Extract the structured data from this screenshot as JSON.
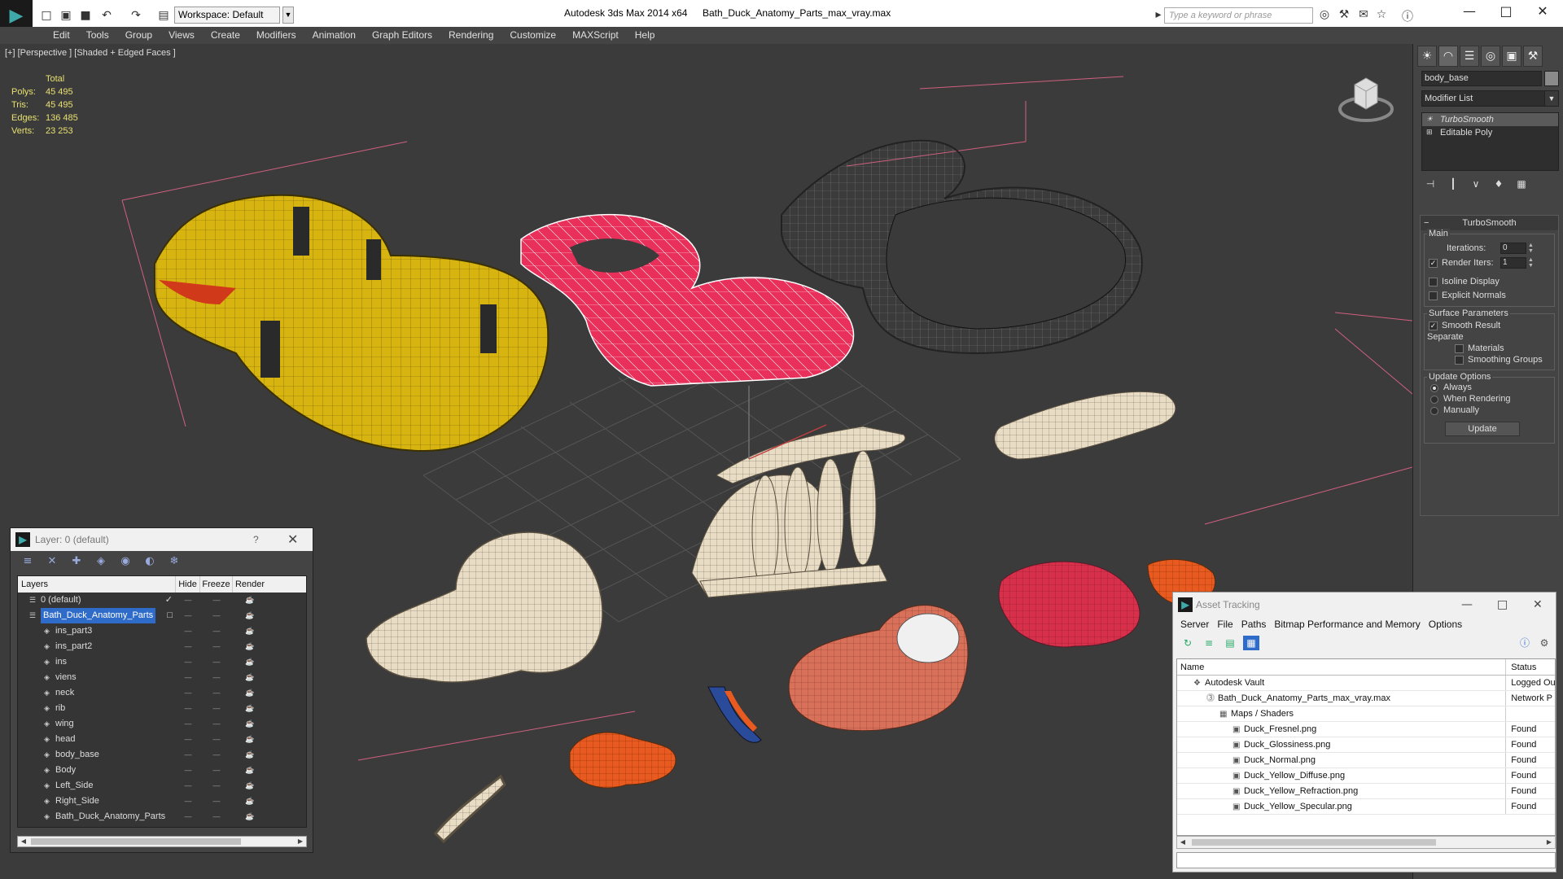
{
  "titlebar": {
    "app_title": "Autodesk 3ds Max  2014 x64",
    "file_title": "Bath_Duck_Anatomy_Parts_max_vray.max",
    "workspace": "Workspace: Default",
    "search_placeholder": "Type a keyword or phrase"
  },
  "menu": [
    "Edit",
    "Tools",
    "Group",
    "Views",
    "Create",
    "Modifiers",
    "Animation",
    "Graph Editors",
    "Rendering",
    "Customize",
    "MAXScript",
    "Help"
  ],
  "viewport": {
    "label": "[+] [Perspective ] [Shaded + Edged Faces ]",
    "stats_header": "Total",
    "stats": [
      {
        "label": "Polys:",
        "value": "45 495"
      },
      {
        "label": "Tris:",
        "value": "45 495"
      },
      {
        "label": "Edges:",
        "value": "136 485"
      },
      {
        "label": "Verts:",
        "value": "23 253"
      }
    ]
  },
  "command_panel": {
    "object_name": "body_base",
    "modifier_list": "Modifier List",
    "stack": [
      "TurboSmooth",
      "Editable Poly"
    ],
    "rollout_title": "TurboSmooth",
    "main_group": "Main",
    "iterations_label": "Iterations:",
    "iterations_value": "0",
    "render_iters_label": "Render Iters:",
    "render_iters_value": "1",
    "isoline_label": "Isoline Display",
    "explicit_normals_label": "Explicit Normals",
    "surface_params_group": "Surface Parameters",
    "smooth_result_label": "Smooth Result",
    "separate_label": "Separate",
    "materials_label": "Materials",
    "smoothing_groups_label": "Smoothing Groups",
    "update_options_group": "Update Options",
    "always_label": "Always",
    "when_rendering_label": "When Rendering",
    "manually_label": "Manually",
    "update_button": "Update"
  },
  "layer_panel": {
    "title": "Layer: 0 (default)",
    "help": "?",
    "columns": {
      "layers": "Layers",
      "hide": "Hide",
      "freeze": "Freeze",
      "render": "Render"
    },
    "rows": [
      {
        "name": "0 (default)",
        "indent": 0,
        "checked": true,
        "selected": false
      },
      {
        "name": "Bath_Duck_Anatomy_Parts",
        "indent": 0,
        "checked": false,
        "selected": true
      },
      {
        "name": "ins_part3",
        "indent": 1
      },
      {
        "name": "ins_part2",
        "indent": 1
      },
      {
        "name": "ins",
        "indent": 1
      },
      {
        "name": "viens",
        "indent": 1
      },
      {
        "name": "neck",
        "indent": 1
      },
      {
        "name": "rib",
        "indent": 1
      },
      {
        "name": "wing",
        "indent": 1
      },
      {
        "name": "head",
        "indent": 1
      },
      {
        "name": "body_base",
        "indent": 1
      },
      {
        "name": "Body",
        "indent": 1
      },
      {
        "name": "Left_Side",
        "indent": 1
      },
      {
        "name": "Right_Side",
        "indent": 1
      },
      {
        "name": "Bath_Duck_Anatomy_Parts",
        "indent": 1
      }
    ]
  },
  "asset_panel": {
    "title": "Asset Tracking",
    "menu": [
      "Server",
      "File",
      "Paths",
      "Bitmap Performance and Memory",
      "Options"
    ],
    "columns": {
      "name": "Name",
      "status": "Status"
    },
    "rows": [
      {
        "name": "Autodesk Vault",
        "indent": 0,
        "status": "Logged Ou",
        "icon": "vault-icon"
      },
      {
        "name": "Bath_Duck_Anatomy_Parts_max_vray.max",
        "indent": 1,
        "status": "Network P",
        "icon": "max-file-icon"
      },
      {
        "name": "Maps / Shaders",
        "indent": 2,
        "status": "",
        "icon": "maps-folder-icon"
      },
      {
        "name": "Duck_Fresnel.png",
        "indent": 3,
        "status": "Found",
        "icon": "bitmap-icon"
      },
      {
        "name": "Duck_Glossiness.png",
        "indent": 3,
        "status": "Found",
        "icon": "bitmap-icon"
      },
      {
        "name": "Duck_Normal.png",
        "indent": 3,
        "status": "Found",
        "icon": "bitmap-icon"
      },
      {
        "name": "Duck_Yellow_Diffuse.png",
        "indent": 3,
        "status": "Found",
        "icon": "bitmap-icon"
      },
      {
        "name": "Duck_Yellow_Refraction.png",
        "indent": 3,
        "status": "Found",
        "icon": "bitmap-icon"
      },
      {
        "name": "Duck_Yellow_Specular.png",
        "indent": 3,
        "status": "Found",
        "icon": "bitmap-icon"
      }
    ]
  },
  "colors": {
    "viewport_bg": "#3b3b3b",
    "stats_text": "#e8e070",
    "selection_blue": "#2f6bc9",
    "duck_yellow": "#d8b411",
    "pink_part": "#e8305a",
    "bone": "#e8dcc4"
  }
}
